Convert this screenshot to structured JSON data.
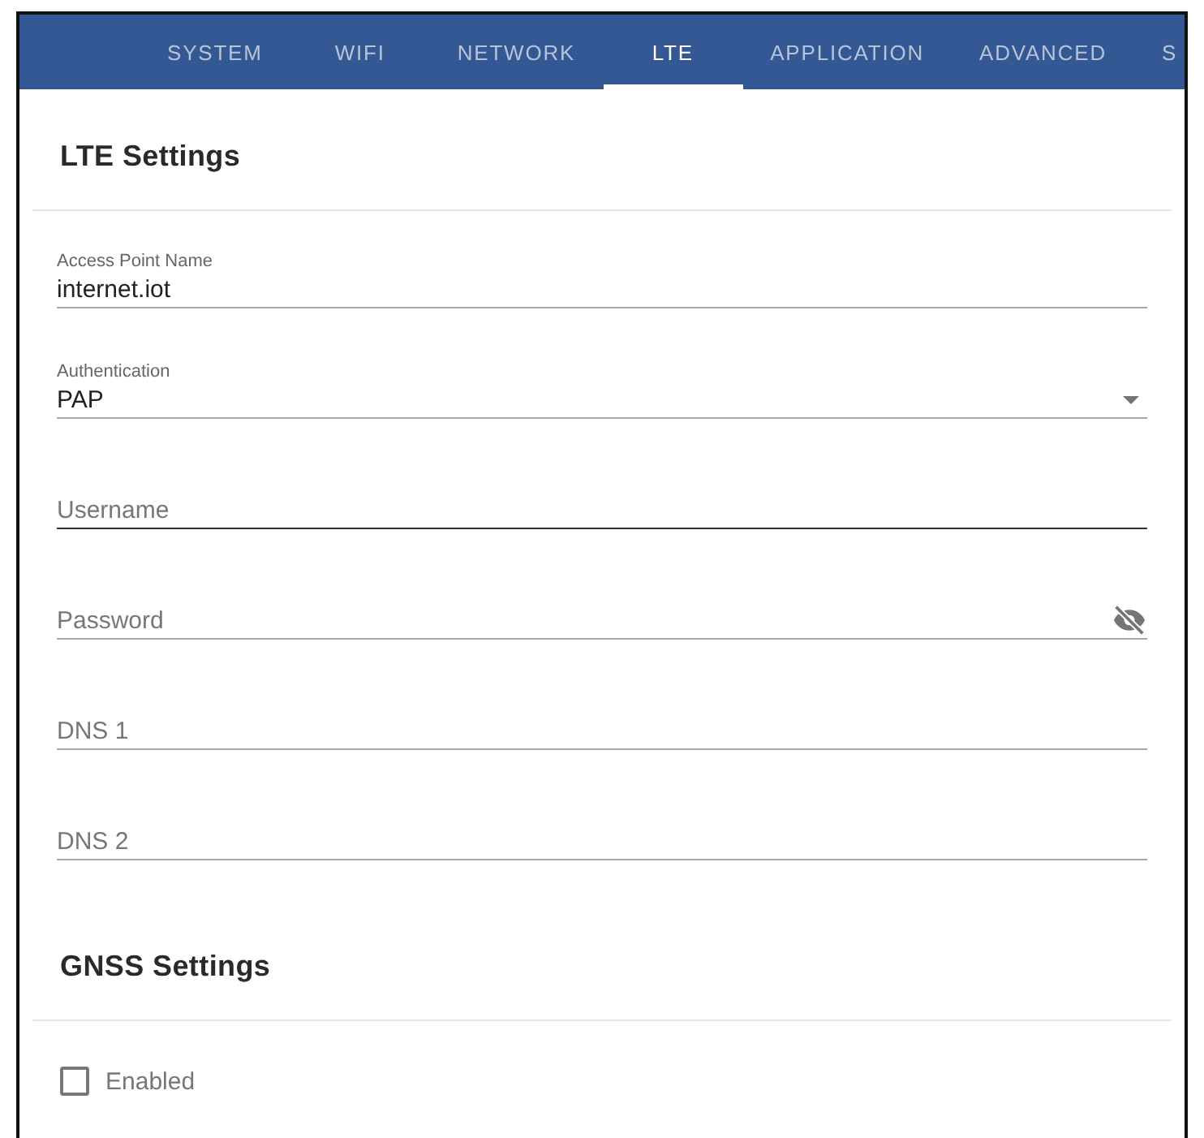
{
  "tabs": [
    {
      "label": "SYSTEM",
      "selected": false
    },
    {
      "label": "WIFI",
      "selected": false
    },
    {
      "label": "NETWORK",
      "selected": false
    },
    {
      "label": "LTE",
      "selected": true
    },
    {
      "label": "APPLICATION",
      "selected": false
    },
    {
      "label": "ADVANCED",
      "selected": false
    },
    {
      "label": "S",
      "selected": false
    }
  ],
  "sections": [
    {
      "title": "LTE Settings",
      "fields": [
        {
          "kind": "text",
          "label": "Access Point Name",
          "value": "internet.iot",
          "active": false
        },
        {
          "kind": "select",
          "label": "Authentication",
          "value": "PAP",
          "active": false
        },
        {
          "kind": "text",
          "placeholder": "Username",
          "active": true
        },
        {
          "kind": "password",
          "placeholder": "Password",
          "active": false
        },
        {
          "kind": "text",
          "placeholder": "DNS 1",
          "active": false
        },
        {
          "kind": "text",
          "placeholder": "DNS 2",
          "active": false
        }
      ]
    },
    {
      "title": "GNSS Settings",
      "fields": [
        {
          "kind": "checkbox",
          "label": "Enabled",
          "checked": false
        }
      ]
    }
  ]
}
